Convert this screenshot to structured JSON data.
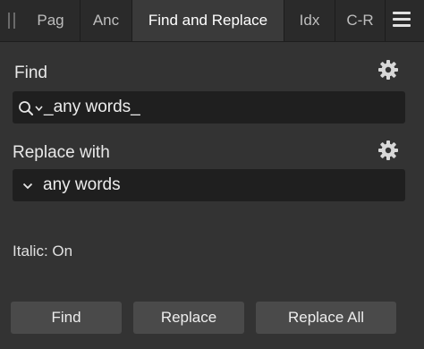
{
  "tabs": [
    {
      "label": "Pag"
    },
    {
      "label": "Anc"
    },
    {
      "label": "Find and Replace"
    },
    {
      "label": "Idx"
    },
    {
      "label": "C-R"
    }
  ],
  "find": {
    "label": "Find",
    "value": "_any words_"
  },
  "replace": {
    "label": "Replace with",
    "value": "any words"
  },
  "status": {
    "text": "Italic: On"
  },
  "buttons": {
    "find": "Find",
    "replace": "Replace",
    "replace_all": "Replace All"
  },
  "icons": {
    "grip": "grip-icon",
    "menu": "hamburger-menu-icon",
    "settings": "gear-icon",
    "search": "search-icon",
    "dropdown": "chevron-down-icon"
  },
  "colors": {
    "panel_bg": "#333333",
    "tab_bar_bg": "#2a2a2a",
    "active_tab_bg": "#3a3a3a",
    "field_bg": "#1f1f1f",
    "button_bg": "#4a4a4a",
    "text": "#e6e6e6"
  }
}
